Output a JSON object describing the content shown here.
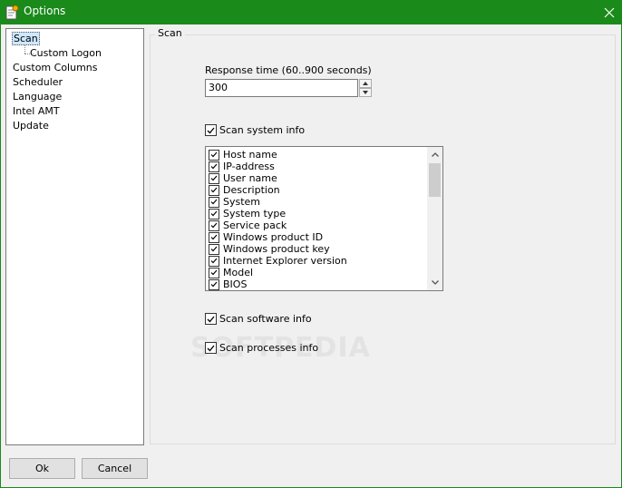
{
  "window": {
    "title": "Options",
    "titlebar_color": "#1a8a1a"
  },
  "tree": {
    "items": [
      {
        "label": "Scan",
        "selected": true
      },
      {
        "label": "Custom Logon",
        "selected": false
      },
      {
        "label": "Custom Columns",
        "selected": false
      },
      {
        "label": "Scheduler",
        "selected": false
      },
      {
        "label": "Language",
        "selected": false
      },
      {
        "label": "Intel AMT",
        "selected": false
      },
      {
        "label": "Update",
        "selected": false
      }
    ]
  },
  "panel": {
    "group_title": "Scan",
    "response_time": {
      "label": "Response time (60..900 seconds)",
      "value": "300"
    },
    "scan_system_info": {
      "label": "Scan system info",
      "checked": true
    },
    "system_info_items": [
      {
        "label": "Host name",
        "checked": true
      },
      {
        "label": "IP-address",
        "checked": true
      },
      {
        "label": "User name",
        "checked": true
      },
      {
        "label": "Description",
        "checked": true
      },
      {
        "label": "System",
        "checked": true
      },
      {
        "label": "System type",
        "checked": true
      },
      {
        "label": "Service pack",
        "checked": true
      },
      {
        "label": "Windows product ID",
        "checked": true
      },
      {
        "label": "Windows product key",
        "checked": true
      },
      {
        "label": "Internet Explorer version",
        "checked": true
      },
      {
        "label": "Model",
        "checked": true
      },
      {
        "label": "BIOS",
        "checked": true
      }
    ],
    "scan_software_info": {
      "label": "Scan software info",
      "checked": true
    },
    "scan_processes_info": {
      "label": "Scan processes info",
      "checked": true
    }
  },
  "buttons": {
    "ok": "Ok",
    "cancel": "Cancel"
  },
  "watermark": "SOFTPEDIA"
}
